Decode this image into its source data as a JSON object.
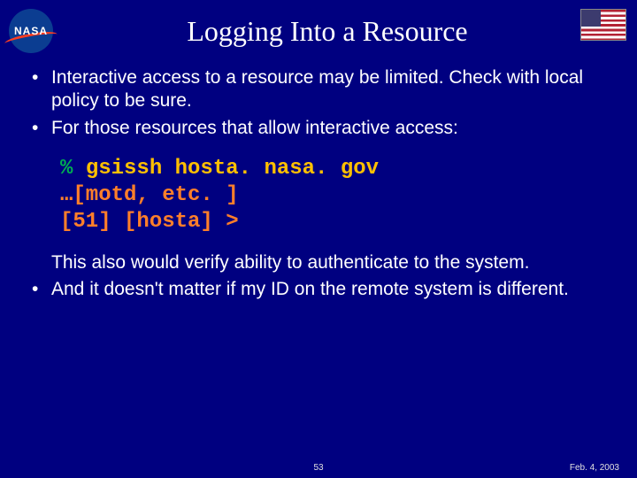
{
  "header": {
    "logo_text": "NASA",
    "title": "Logging Into a Resource"
  },
  "bullets_top": [
    "Interactive access to a resource may be limited.  Check with local policy to be sure.",
    "For those resources that allow interactive access:"
  ],
  "code": {
    "prompt": "%",
    "command": "gsissh hosta. nasa. gov",
    "output1": "…[motd, etc. ]",
    "output2": "[51] [hosta] >"
  },
  "after_code_text": "This also would verify ability to authenticate to the system.",
  "bullets_bottom": [
    "And it doesn't matter if my ID on the remote system is different."
  ],
  "footer": {
    "page": "53",
    "date": "Feb. 4, 2003"
  }
}
